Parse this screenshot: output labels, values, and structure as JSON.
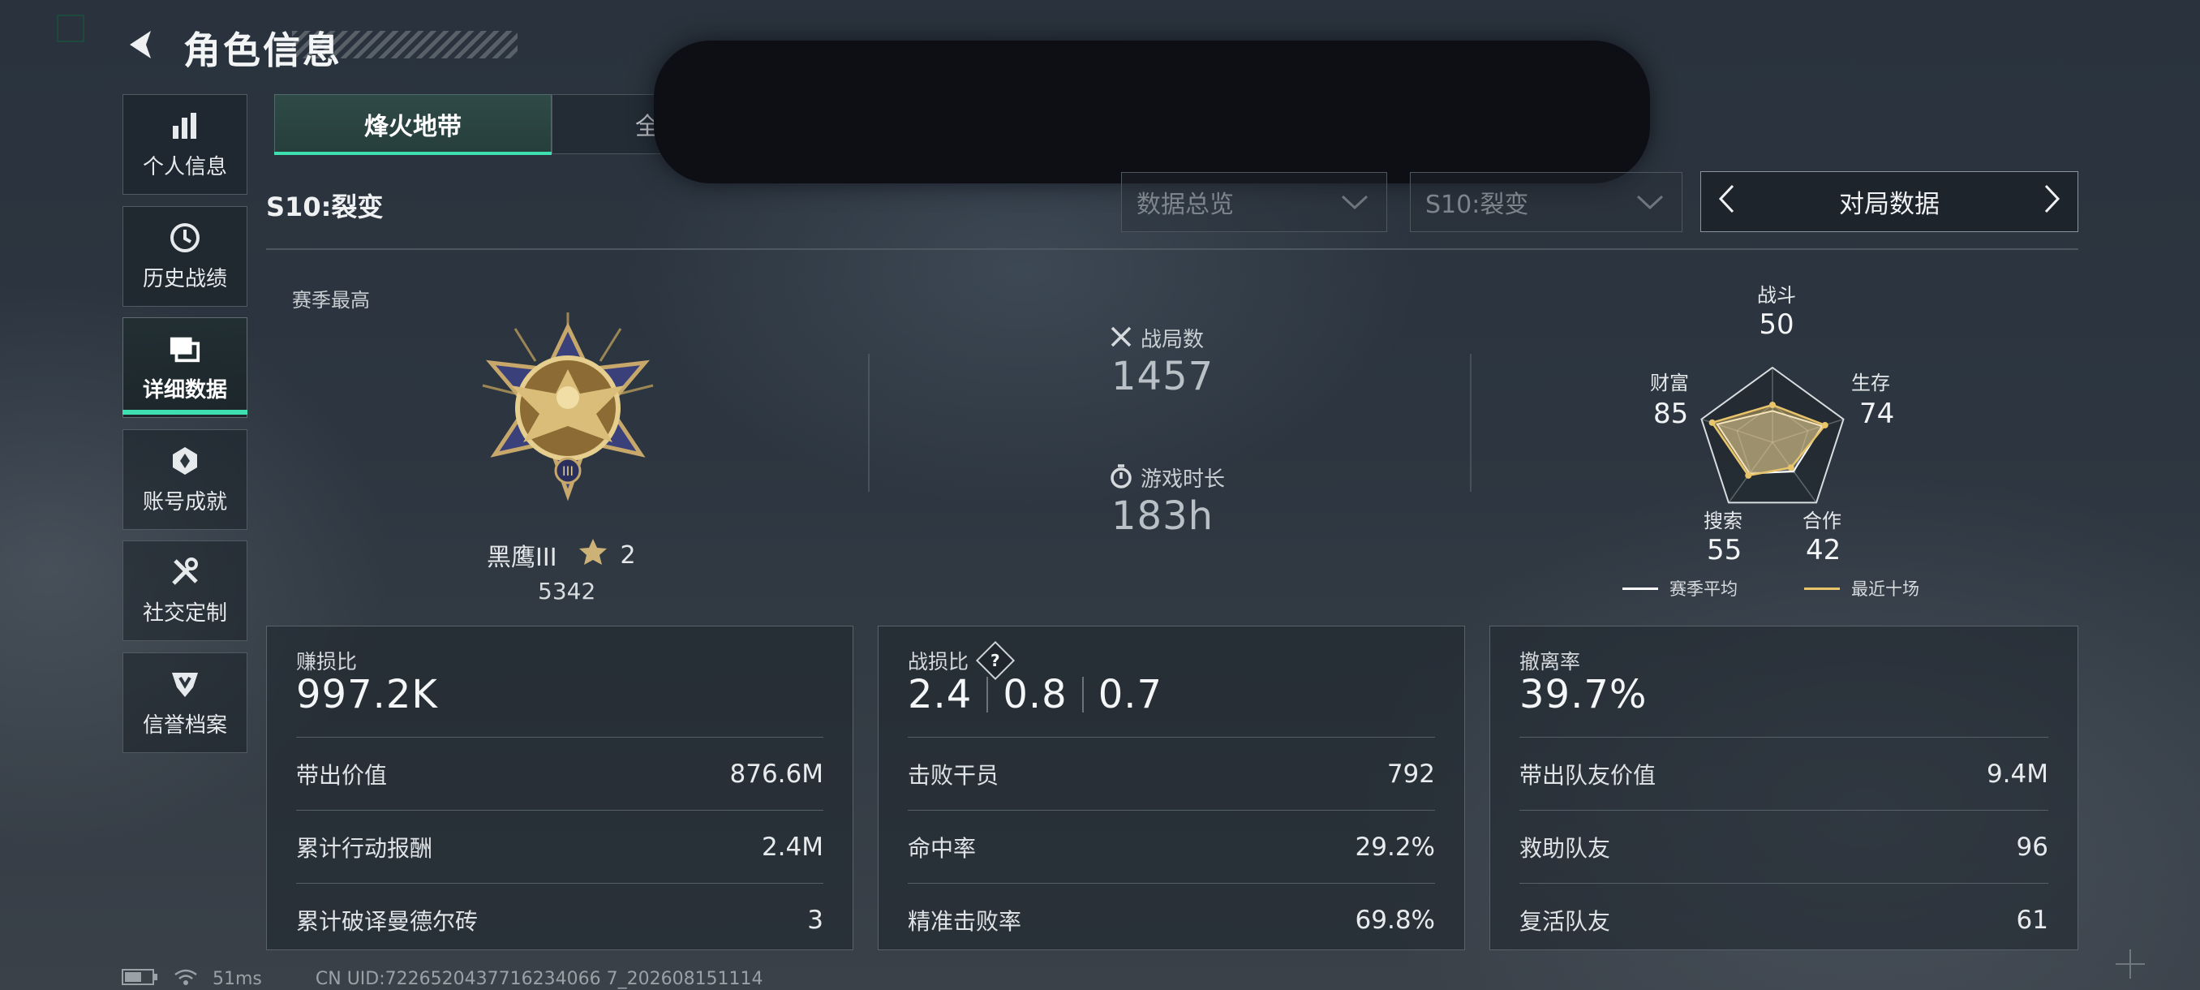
{
  "header": {
    "title": "角色信息",
    "back_icon": "back-arrow-icon"
  },
  "sidebar": {
    "items": [
      {
        "label": "个人信息",
        "icon": "bar-chart-icon"
      },
      {
        "label": "历史战绩",
        "icon": "history-clock-icon"
      },
      {
        "label": "详细数据",
        "icon": "cards-icon",
        "active": true
      },
      {
        "label": "账号成就",
        "icon": "achievement-icon"
      },
      {
        "label": "社交定制",
        "icon": "wrench-icon"
      },
      {
        "label": "信誉档案",
        "icon": "reputation-icon"
      }
    ]
  },
  "tabs": [
    {
      "label": "烽火地带",
      "active": true
    },
    {
      "label": "全",
      "active": false
    }
  ],
  "season_label": "S10:裂变",
  "filters": {
    "overview": "数据总览",
    "season": "S10:裂变",
    "cycler": "对局数据"
  },
  "season_best": {
    "label": "赛季最高",
    "rank_name": "黑鹰III",
    "stars": "2",
    "score": "5342"
  },
  "summary": {
    "matches_label": "战局数",
    "matches_value": "1457",
    "time_label": "游戏时长",
    "time_value": "183h"
  },
  "radar": {
    "axes": [
      {
        "label": "战斗",
        "value": "50"
      },
      {
        "label": "生存",
        "value": "74"
      },
      {
        "label": "合作",
        "value": "42"
      },
      {
        "label": "搜索",
        "value": "55"
      },
      {
        "label": "财富",
        "value": "85"
      }
    ],
    "season_avg_values": [
      42,
      70,
      48,
      52,
      78
    ],
    "recent_values": [
      50,
      74,
      42,
      55,
      85
    ],
    "legend_avg": "赛季平均",
    "legend_recent": "最近十场",
    "colors": {
      "avg": "#ffffff",
      "recent": "#e8c46a"
    }
  },
  "cards": {
    "profit": {
      "header": "赚损比",
      "main": "997.2K",
      "rows": [
        {
          "k": "带出价值",
          "v": "876.6M"
        },
        {
          "k": "累计行动报酬",
          "v": "2.4M"
        },
        {
          "k": "累计破译曼德尔砖",
          "v": "3"
        }
      ]
    },
    "kd": {
      "header": "战损比",
      "main_values": [
        "2.4",
        "0.8",
        "0.7"
      ],
      "rows": [
        {
          "k": "击败干员",
          "v": "792"
        },
        {
          "k": "命中率",
          "v": "29.2%"
        },
        {
          "k": "精准击败率",
          "v": "69.8%"
        }
      ]
    },
    "extract": {
      "header": "撤离率",
      "main": "39.7%",
      "rows": [
        {
          "k": "带出队友价值",
          "v": "9.4M"
        },
        {
          "k": "救助队友",
          "v": "96"
        },
        {
          "k": "复活队友",
          "v": "61"
        }
      ]
    }
  },
  "status_bar": {
    "ping": "51ms",
    "uid": "CN UID:7226520437716234066 7_202608151114"
  },
  "accent_color": "#3ee0b0"
}
